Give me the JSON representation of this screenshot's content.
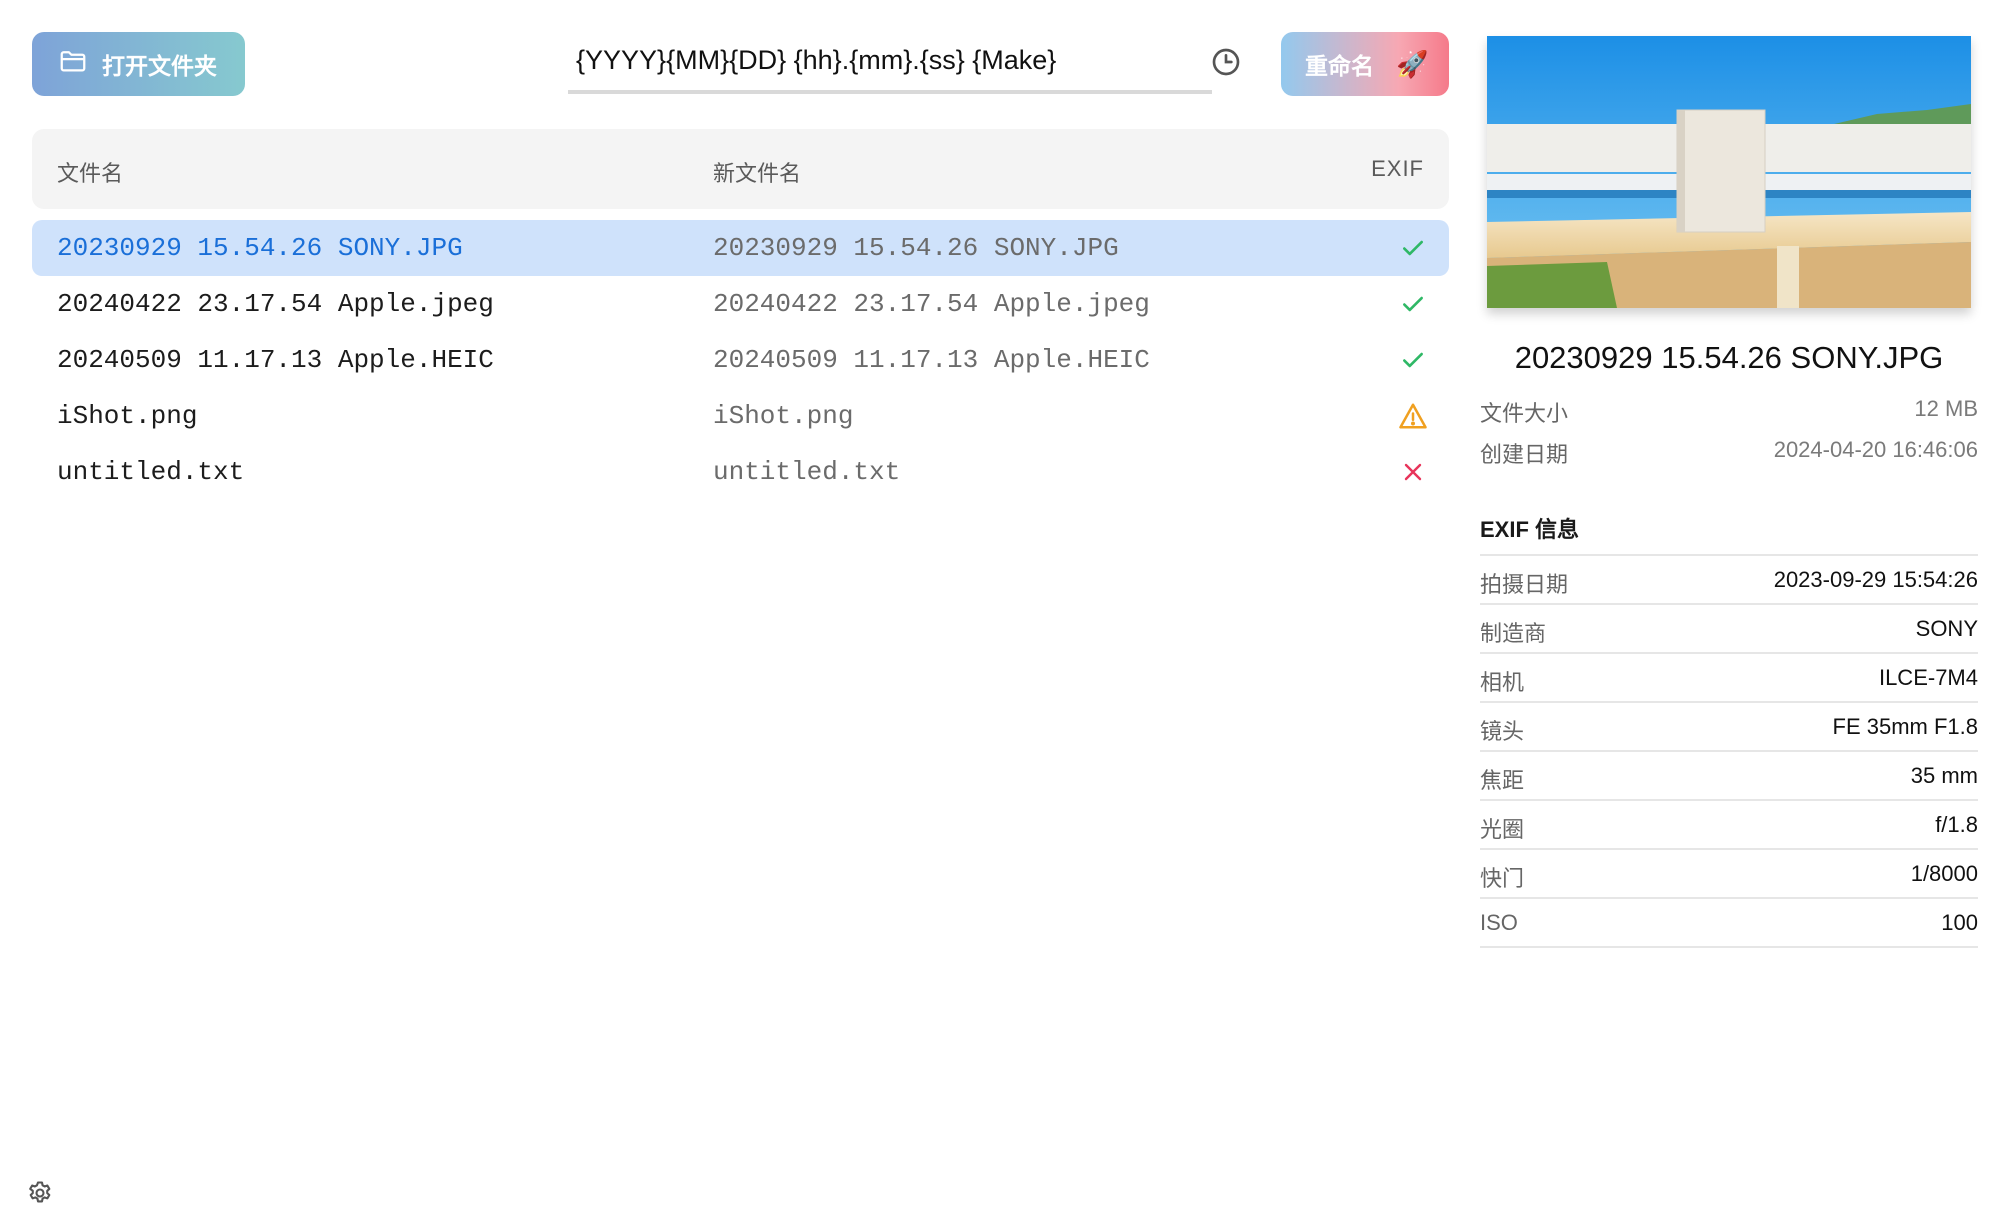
{
  "toolbar": {
    "open_label": "打开文件夹",
    "template_value": "{YYYY}{MM}{DD} {hh}.{mm}.{ss} {Make}",
    "rename_label": "重命名",
    "rename_emoji": "🚀",
    "icons": {
      "open": "folder-open-icon",
      "history": "clock-history-icon",
      "settings": "gear-icon"
    }
  },
  "table": {
    "headers": {
      "name": "文件名",
      "new_name": "新文件名",
      "exif": "EXIF"
    },
    "rows": [
      {
        "name": "20230929 15.54.26 SONY.JPG",
        "new_name": "20230929 15.54.26 SONY.JPG",
        "status": "ok",
        "selected": true
      },
      {
        "name": "20240422 23.17.54 Apple.jpeg",
        "new_name": "20240422 23.17.54 Apple.jpeg",
        "status": "ok",
        "selected": false
      },
      {
        "name": "20240509 11.17.13 Apple.HEIC",
        "new_name": "20240509 11.17.13 Apple.HEIC",
        "status": "ok",
        "selected": false
      },
      {
        "name": "iShot.png",
        "new_name": "iShot.png",
        "status": "warning",
        "selected": false
      },
      {
        "name": "untitled.txt",
        "new_name": "untitled.txt",
        "status": "error",
        "selected": false
      }
    ]
  },
  "colors": {
    "selected_row": "#cfe2fb",
    "selected_text": "#1a6fd8",
    "ok": "#2fb866",
    "warning": "#f0a020",
    "error": "#e8345a"
  },
  "preview": {
    "title": "20230929 15.54.26 SONY.JPG",
    "file_size_label": "文件大小",
    "file_size": "12 MB",
    "created_label": "创建日期",
    "created": "2024-04-20 16:46:06"
  },
  "exif": {
    "heading": "EXIF 信息",
    "rows": [
      {
        "key": "拍摄日期",
        "value": "2023-09-29 15:54:26"
      },
      {
        "key": "制造商",
        "value": "SONY"
      },
      {
        "key": "相机",
        "value": "ILCE-7M4"
      },
      {
        "key": "镜头",
        "value": "FE 35mm F1.8"
      },
      {
        "key": "焦距",
        "value": "35 mm"
      },
      {
        "key": "光圈",
        "value": "f/1.8"
      },
      {
        "key": "快门",
        "value": "1/8000"
      },
      {
        "key": "ISO",
        "value": "100"
      }
    ]
  }
}
